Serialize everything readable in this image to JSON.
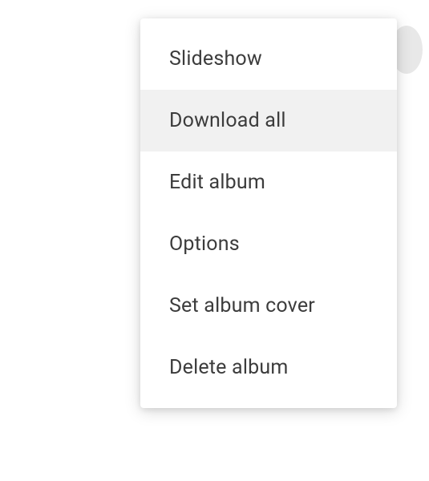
{
  "menu": {
    "items": [
      {
        "label": "Slideshow",
        "hovered": false
      },
      {
        "label": "Download all",
        "hovered": true
      },
      {
        "label": "Edit album",
        "hovered": false
      },
      {
        "label": "Options",
        "hovered": false
      },
      {
        "label": "Set album cover",
        "hovered": false
      },
      {
        "label": "Delete album",
        "hovered": false
      }
    ]
  }
}
